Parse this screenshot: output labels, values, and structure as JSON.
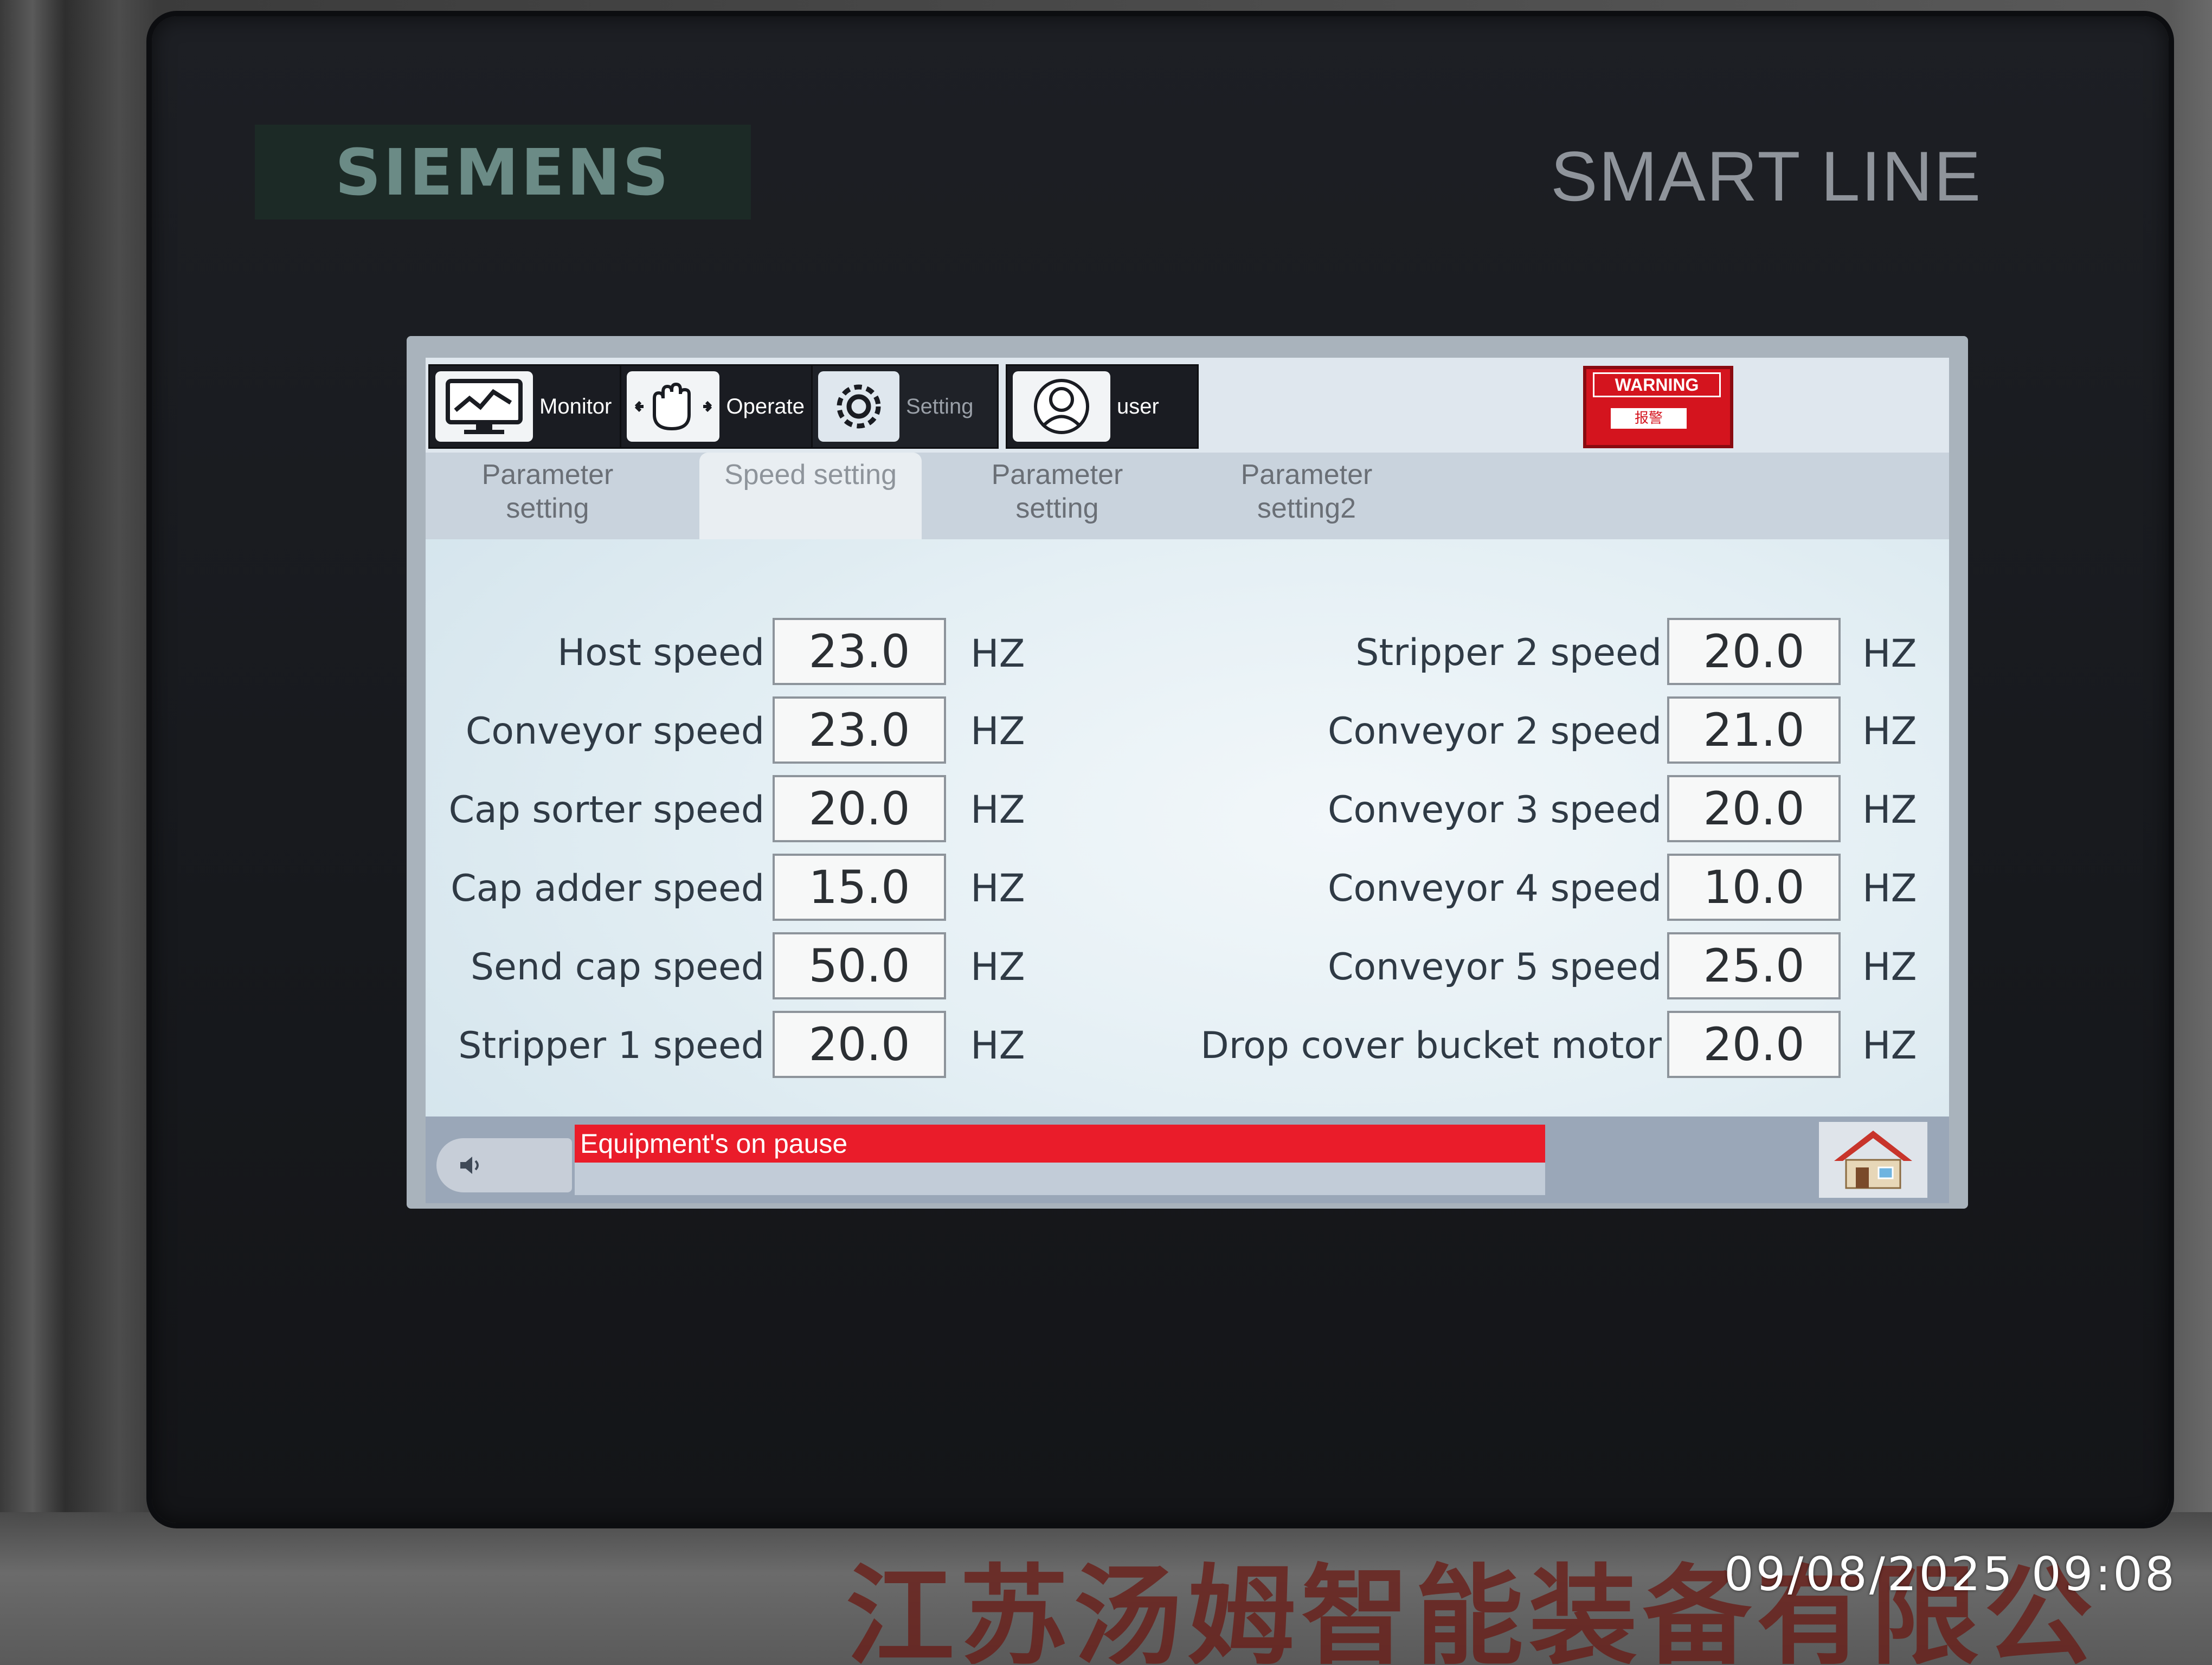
{
  "hardware": {
    "brand": "SIEMENS",
    "series": "SMART LINE",
    "company_text": "江苏汤姆智能装备有限公"
  },
  "nav": {
    "monitor_label": "Monitor",
    "operate_label": "Operate",
    "setting_label": "Setting",
    "user_label": "user",
    "warning_label": "WARNING",
    "warning_sub": "报警"
  },
  "tabs": [
    {
      "label": "Parameter setting",
      "active": false
    },
    {
      "label": "Speed setting",
      "active": true
    },
    {
      "label": "Parameter setting",
      "active": false
    },
    {
      "label": "Parameter setting2",
      "active": false
    }
  ],
  "left_rows": [
    {
      "label": "Host speed",
      "value": "23.0",
      "unit": "HZ"
    },
    {
      "label": "Conveyor speed",
      "value": "23.0",
      "unit": "HZ"
    },
    {
      "label": "Cap sorter speed",
      "value": "20.0",
      "unit": "HZ"
    },
    {
      "label": "Cap adder speed",
      "value": "15.0",
      "unit": "HZ"
    },
    {
      "label": "Send cap speed",
      "value": "50.0",
      "unit": "HZ"
    },
    {
      "label": "Stripper 1 speed",
      "value": "20.0",
      "unit": "HZ"
    }
  ],
  "right_rows": [
    {
      "label": "Stripper 2 speed",
      "value": "20.0",
      "unit": "HZ"
    },
    {
      "label": "Conveyor 2 speed",
      "value": "21.0",
      "unit": "HZ"
    },
    {
      "label": "Conveyor 3 speed",
      "value": "20.0",
      "unit": "HZ"
    },
    {
      "label": "Conveyor 4 speed",
      "value": "10.0",
      "unit": "HZ"
    },
    {
      "label": "Conveyor 5 speed",
      "value": "25.0",
      "unit": "HZ"
    },
    {
      "label": "Drop cover bucket motor",
      "value": "20.0",
      "unit": "HZ"
    }
  ],
  "status": {
    "alarm_text": "Equipment's on pause"
  },
  "timestamp": "09/08/2025 09:08",
  "colors": {
    "alarm": "#ea1c2a",
    "warning": "#d4141e"
  }
}
